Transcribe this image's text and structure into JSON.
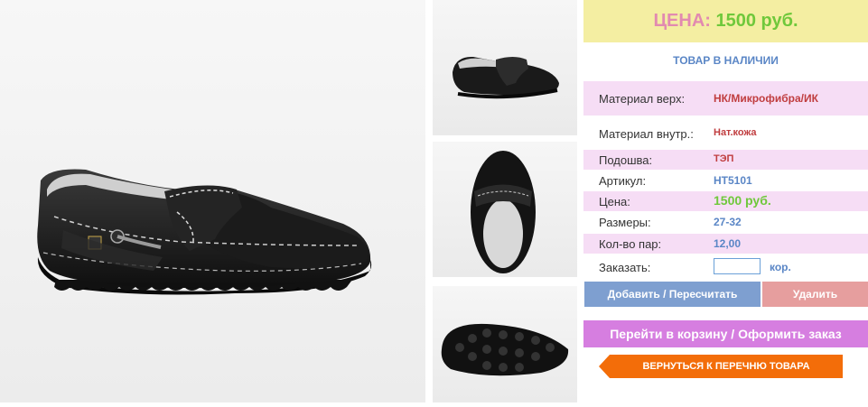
{
  "price": {
    "label": "ЦЕНА:",
    "value": "1500 руб."
  },
  "stock_status": "ТОВАР В НАЛИЧИИ",
  "specs": [
    {
      "key": "Материал верх:",
      "value": "НК/Микрофибра/ИК"
    },
    {
      "key": "Материал внутр.:",
      "value": "Нат.кожа"
    },
    {
      "key": "Подошва:",
      "value": "ТЭП"
    },
    {
      "key": "Артикул:",
      "value": "НТ5101"
    },
    {
      "key": "Цена:",
      "value": "1500 руб."
    },
    {
      "key": "Размеры:",
      "value": "27-32"
    },
    {
      "key": "Кол-во пар:",
      "value": "12,00"
    }
  ],
  "order": {
    "label": "Заказать:",
    "value": "",
    "unit": "кор."
  },
  "buttons": {
    "add": "Добавить / Пересчитать",
    "delete": "Удалить",
    "cart": "Перейти в корзину / Оформить заказ",
    "back": "ВЕРНУТЬСЯ К ПЕРЕЧНЮ ТОВАРА"
  },
  "colors": {
    "price_bg": "#f4eea2",
    "pink_row": "#f6ddf5",
    "add_button": "#7e9fd0",
    "delete_button": "#e69e9e",
    "cart_button": "#d67ee0",
    "back_button": "#f36d09"
  },
  "images": [
    "shoe-side-view",
    "shoe-top-view-thumbnail",
    "shoe-inside-view-thumbnail",
    "shoe-sole-view-thumbnail"
  ]
}
